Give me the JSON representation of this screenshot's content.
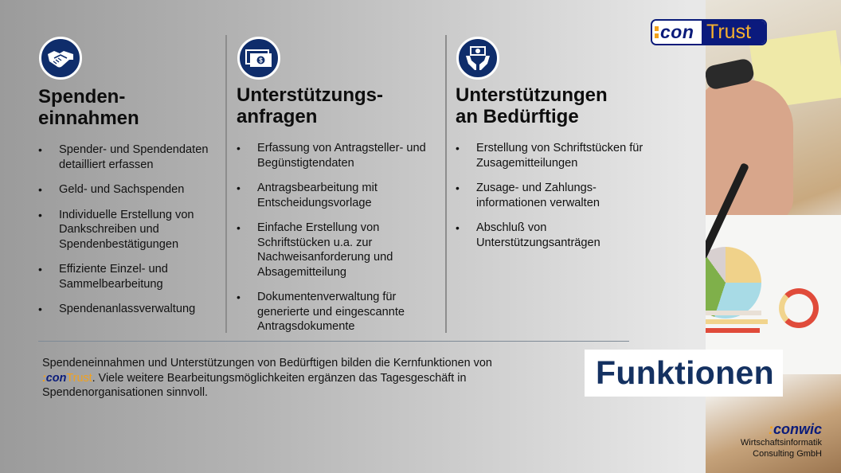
{
  "brand": {
    "logo_prefix": "con",
    "logo_suffix": "Trust",
    "colors": {
      "navy": "#0b1a7d",
      "orange": "#f3a11b",
      "icon_blue": "#0f2d6b",
      "title_blue": "#143161"
    }
  },
  "columns": [
    {
      "icon": "handshake-icon",
      "heading_line1": "Spenden-",
      "heading_line2": "einnahmen",
      "items": [
        "Spender- und Spendendaten detailliert erfassen",
        "Geld- und Sachspenden",
        "Individuelle Erstellung von Dankschreiben und Spendenbestätigungen",
        "Effiziente Einzel- und Sammelbearbeitung",
        "Spendenanlassverwaltung"
      ]
    },
    {
      "icon": "money-bill-icon",
      "heading_line1": "Unterstützungs-",
      "heading_line2": "anfragen",
      "items": [
        "Erfassung von Antragsteller- und Begünstigtendaten",
        "Antragsbearbeitung mit Entscheidungsvorlage",
        "Einfache Erstellung von Schriftstücken u.a. zur Nachweisanforderung und Absagemitteilung",
        "Dokumentenverwaltung für generierte und eingescannte Antragsdokumente"
      ]
    },
    {
      "icon": "hands-money-icon",
      "heading_line1": "Unterstützungen",
      "heading_line2": "an Bedürftige",
      "items": [
        "Erstellung von Schriftstücken für Zusagemitteilungen",
        "Zusage- und Zahlungs-informationen verwalten",
        "Abschluß von Unterstützungsanträgen"
      ]
    }
  ],
  "summary": {
    "part1": "Spendeneinnahmen und Unterstützungen von Bedürftigen bilden die Kernfunktionen von ",
    "inline_logo_colon": ":",
    "inline_logo_con": "con",
    "inline_logo_trust": "Trust",
    "part2": ". Viele weitere Bearbeitungsmöglichkeiten ergänzen das Tagesgeschäft in Spendenorganisationen sinnvoll."
  },
  "title": "Funktionen",
  "company": {
    "logo_colon": ":",
    "logo_name": "conwic",
    "line1": "Wirtschaftsinformatik",
    "line2": "Consulting GmbH"
  }
}
